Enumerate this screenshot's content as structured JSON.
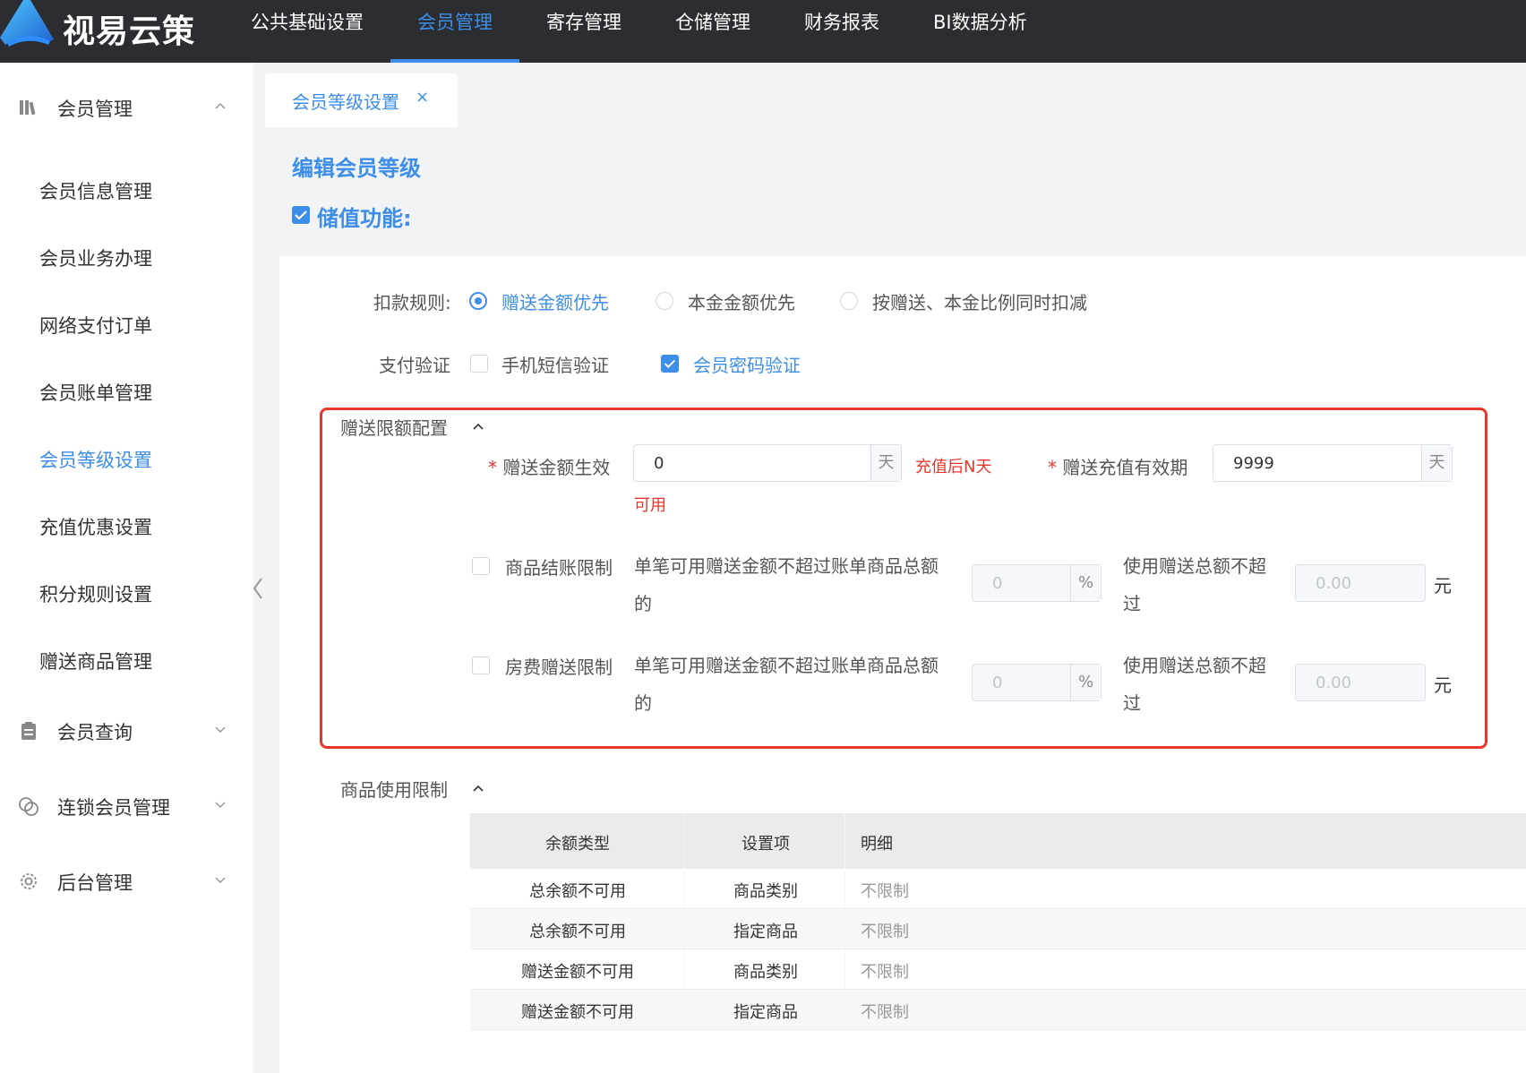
{
  "app": {
    "logo_text": "视易云策",
    "brand_color": "#3d8ee8"
  },
  "topnav": [
    {
      "label": "公共基础设置"
    },
    {
      "label": "会员管理"
    },
    {
      "label": "寄存管理"
    },
    {
      "label": "仓储管理"
    },
    {
      "label": "财务报表"
    },
    {
      "label": "BI数据分析"
    }
  ],
  "sidebar": {
    "group1": {
      "label": "会员管理",
      "icon": "books-icon"
    },
    "items": [
      {
        "label": "会员信息管理"
      },
      {
        "label": "会员业务办理"
      },
      {
        "label": "网络支付订单"
      },
      {
        "label": "会员账单管理"
      },
      {
        "label": "会员等级设置"
      },
      {
        "label": "充值优惠设置"
      },
      {
        "label": "积分规则设置"
      },
      {
        "label": "赠送商品管理"
      }
    ],
    "group2": {
      "label": "会员查询",
      "icon": "clipboard-icon"
    },
    "group3": {
      "label": "连锁会员管理",
      "icon": "linked-circles-icon"
    },
    "group4": {
      "label": "后台管理",
      "icon": "gear-icon"
    }
  },
  "tab": {
    "label": "会员等级设置",
    "close": "×"
  },
  "page": {
    "title": "编辑会员等级",
    "stored_value_label": "储值功能:"
  },
  "deduct": {
    "label": "扣款规则:",
    "options": [
      "赠送金额优先",
      "本金金额优先",
      "按赠送、本金比例同时扣减"
    ]
  },
  "verify": {
    "label": "支付验证",
    "sms": "手机短信验证",
    "password": "会员密码验证"
  },
  "gift_limit": {
    "section_label": "赠送限额配置",
    "effect_label": "赠送金额生效",
    "effect_value": "0",
    "effect_unit": "天",
    "effect_hint_1": "充值后N天",
    "effect_hint_2": "可用",
    "validity_label": "赠送充值有效期",
    "validity_value": "9999",
    "validity_unit": "天",
    "goods_row": {
      "label": "商品结账限制",
      "desc_1": "单笔可用赠送金额不超过账单商品总额",
      "desc_2": "的",
      "percent_value": "0",
      "percent_unit": "%",
      "total_1": "使用赠送总额不超",
      "total_2": "过",
      "amount_value": "0.00",
      "amount_unit": "元"
    },
    "room_row": {
      "label": "房费赠送限制",
      "desc_1": "单笔可用赠送金额不超过账单商品总额",
      "desc_2": "的",
      "percent_value": "0",
      "percent_unit": "%",
      "total_1": "使用赠送总额不超",
      "total_2": "过",
      "amount_value": "0.00",
      "amount_unit": "元"
    }
  },
  "goods_usage": {
    "section_label": "商品使用限制",
    "columns": [
      "余额类型",
      "设置项",
      "明细"
    ],
    "rows": [
      [
        "总余额不可用",
        "商品类别",
        "不限制"
      ],
      [
        "总余额不可用",
        "指定商品",
        "不限制"
      ],
      [
        "赠送金额不可用",
        "商品类别",
        "不限制"
      ],
      [
        "赠送金额不可用",
        "指定商品",
        "不限制"
      ]
    ]
  }
}
